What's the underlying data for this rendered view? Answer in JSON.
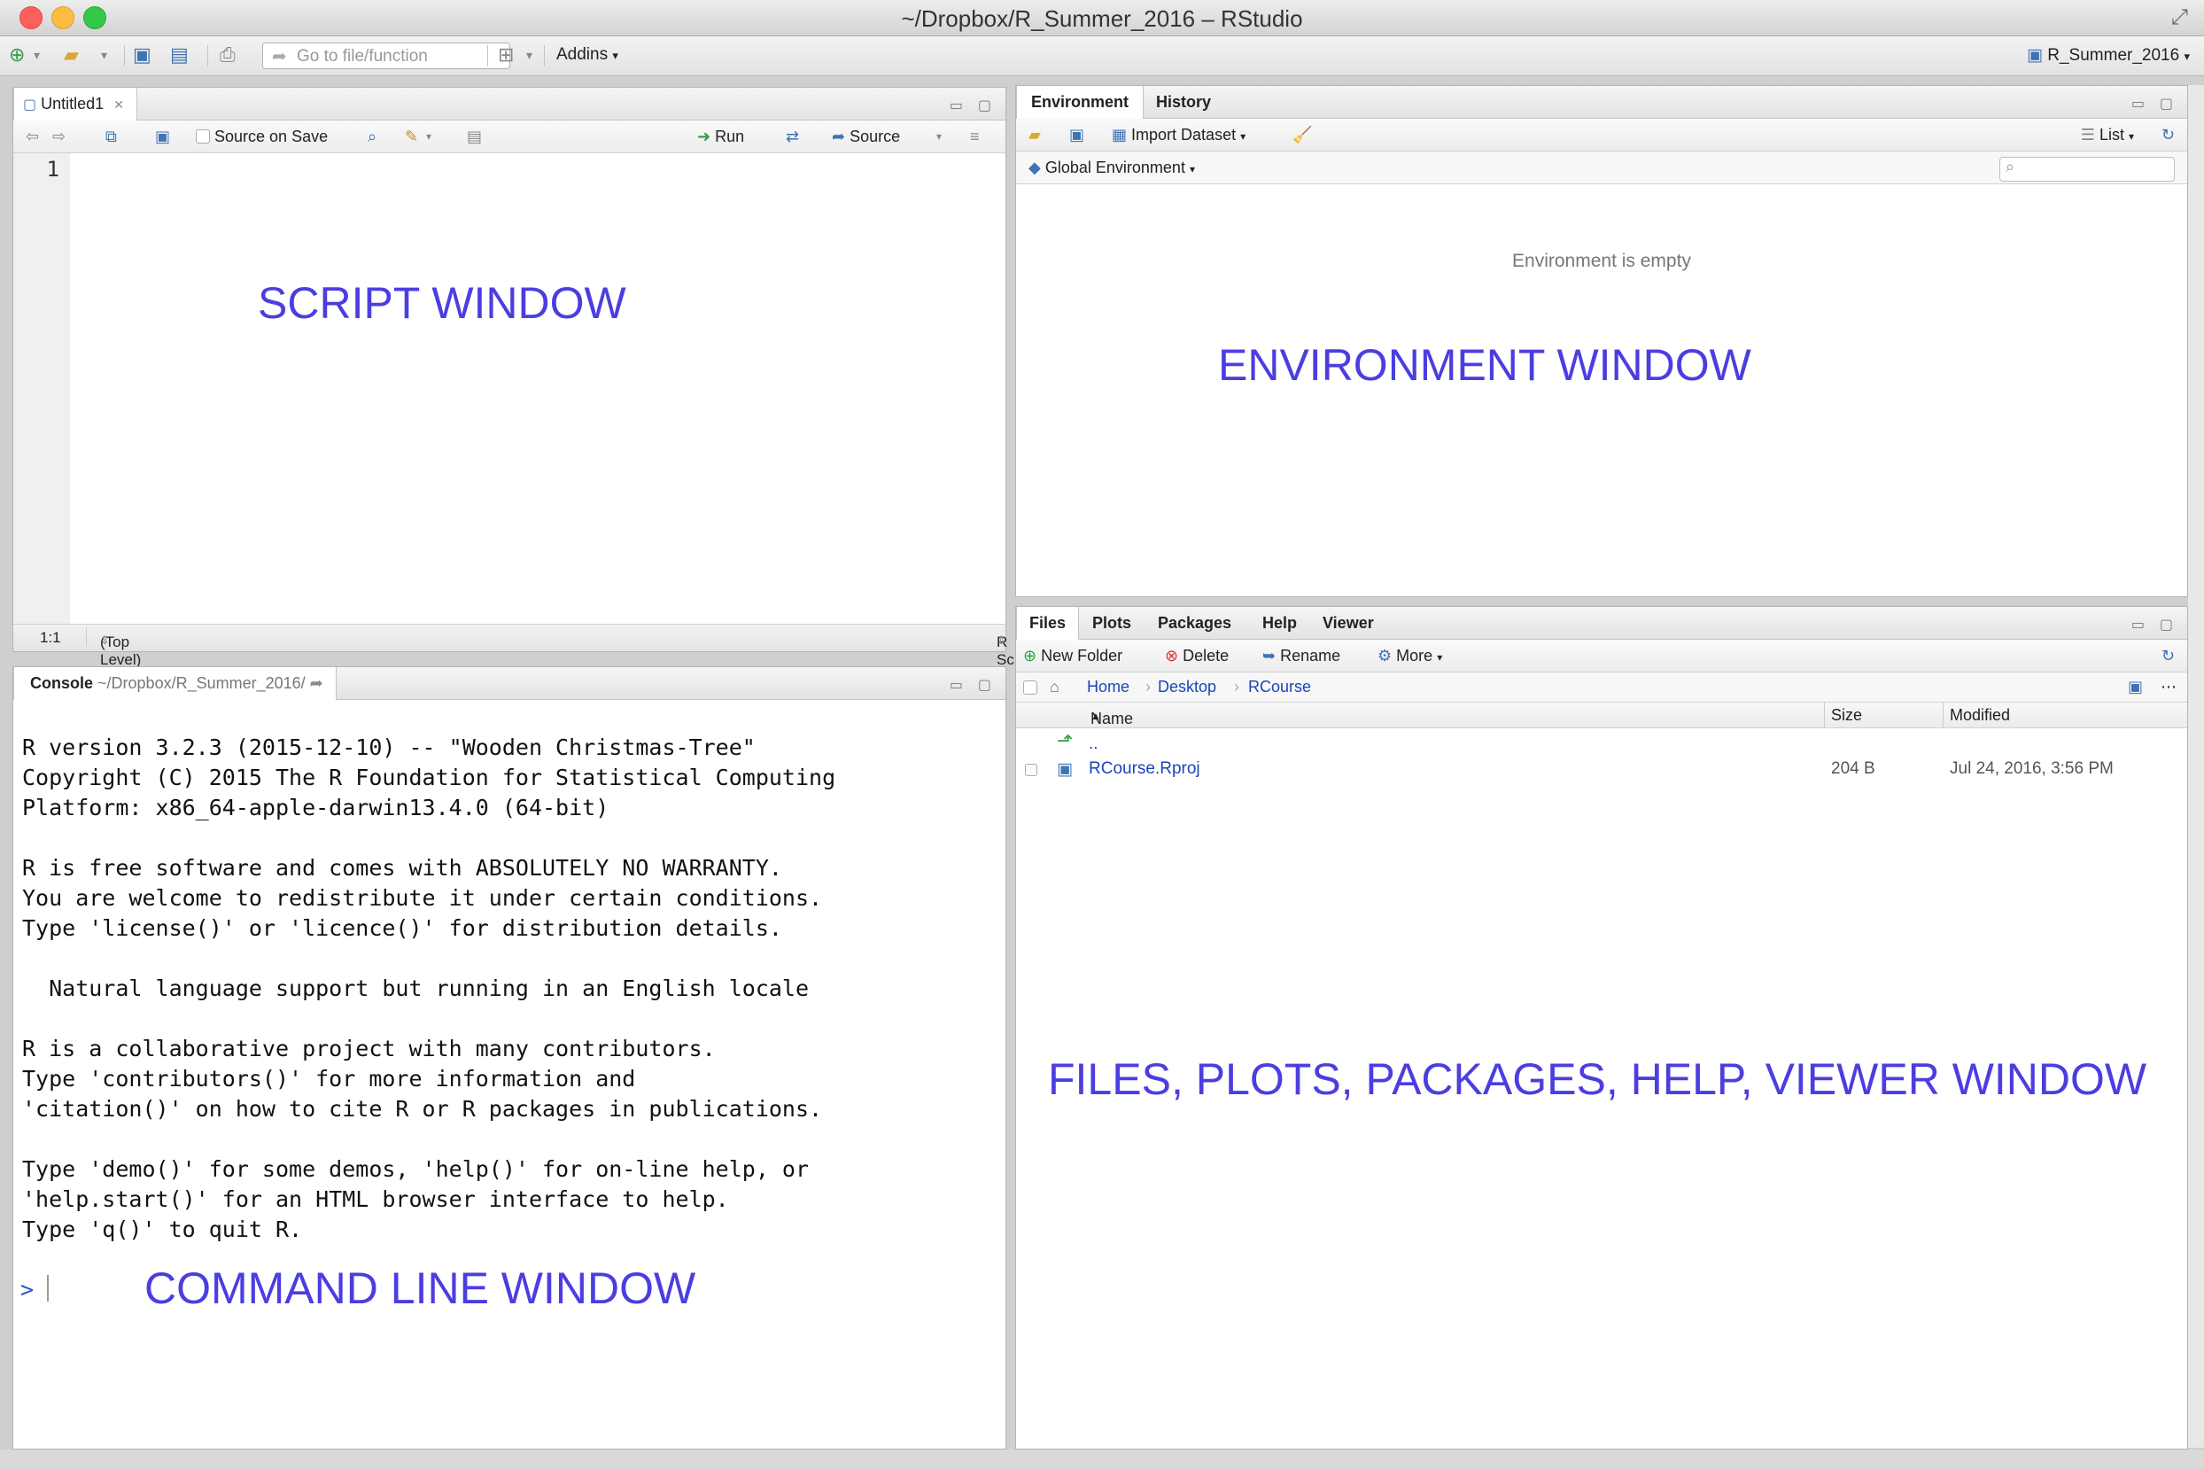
{
  "window": {
    "title": "~/Dropbox/R_Summer_2016 – RStudio",
    "fullscreen_glyph": "⤢"
  },
  "toolbar": {
    "goto_placeholder": "Go to file/function",
    "addins_label": "Addins",
    "project_label": "R_Summer_2016"
  },
  "script": {
    "tab_label": "Untitled1",
    "source_on_save_label": "Source on Save",
    "run_label": "Run",
    "source_label": "Source",
    "line_number": "1",
    "overlay": "SCRIPT WINDOW",
    "status": {
      "position": "1:1",
      "scope": "(Top Level)",
      "filetype": "R Script"
    }
  },
  "console": {
    "tab_label": "Console",
    "path": "~/Dropbox/R_Summer_2016/",
    "text": "R version 3.2.3 (2015-12-10) -- \"Wooden Christmas-Tree\"\nCopyright (C) 2015 The R Foundation for Statistical Computing\nPlatform: x86_64-apple-darwin13.4.0 (64-bit)\n\nR is free software and comes with ABSOLUTELY NO WARRANTY.\nYou are welcome to redistribute it under certain conditions.\nType 'license()' or 'licence()' for distribution details.\n\n  Natural language support but running in an English locale\n\nR is a collaborative project with many contributors.\nType 'contributors()' for more information and\n'citation()' on how to cite R or R packages in publications.\n\nType 'demo()' for some demos, 'help()' for on-line help, or\n'help.start()' for an HTML browser interface to help.\nType 'q()' to quit R.",
    "prompt": ">",
    "overlay": "COMMAND LINE WINDOW"
  },
  "environment": {
    "tabs": [
      "Environment",
      "History"
    ],
    "import_label": "Import Dataset",
    "list_label": "List",
    "scope_label": "Global Environment",
    "empty_message": "Environment is empty",
    "overlay": "ENVIRONMENT WINDOW"
  },
  "files": {
    "tabs": [
      "Files",
      "Plots",
      "Packages",
      "Help",
      "Viewer"
    ],
    "actions": {
      "new_folder": "New Folder",
      "delete": "Delete",
      "rename": "Rename",
      "more": "More"
    },
    "breadcrumb": [
      "Home",
      "Desktop",
      "RCourse"
    ],
    "columns": {
      "name": "Name",
      "size": "Size",
      "modified": "Modified"
    },
    "rows": [
      {
        "name": "..",
        "size": "",
        "modified": ""
      },
      {
        "name": "RCourse.Rproj",
        "size": "204 B",
        "modified": "Jul 24, 2016, 3:56 PM"
      }
    ],
    "overlay": "FILES, PLOTS, PACKAGES, HELP, VIEWER WINDOW"
  },
  "colors": {
    "overlay": "#4b3ee0",
    "link": "#1a45b8"
  }
}
